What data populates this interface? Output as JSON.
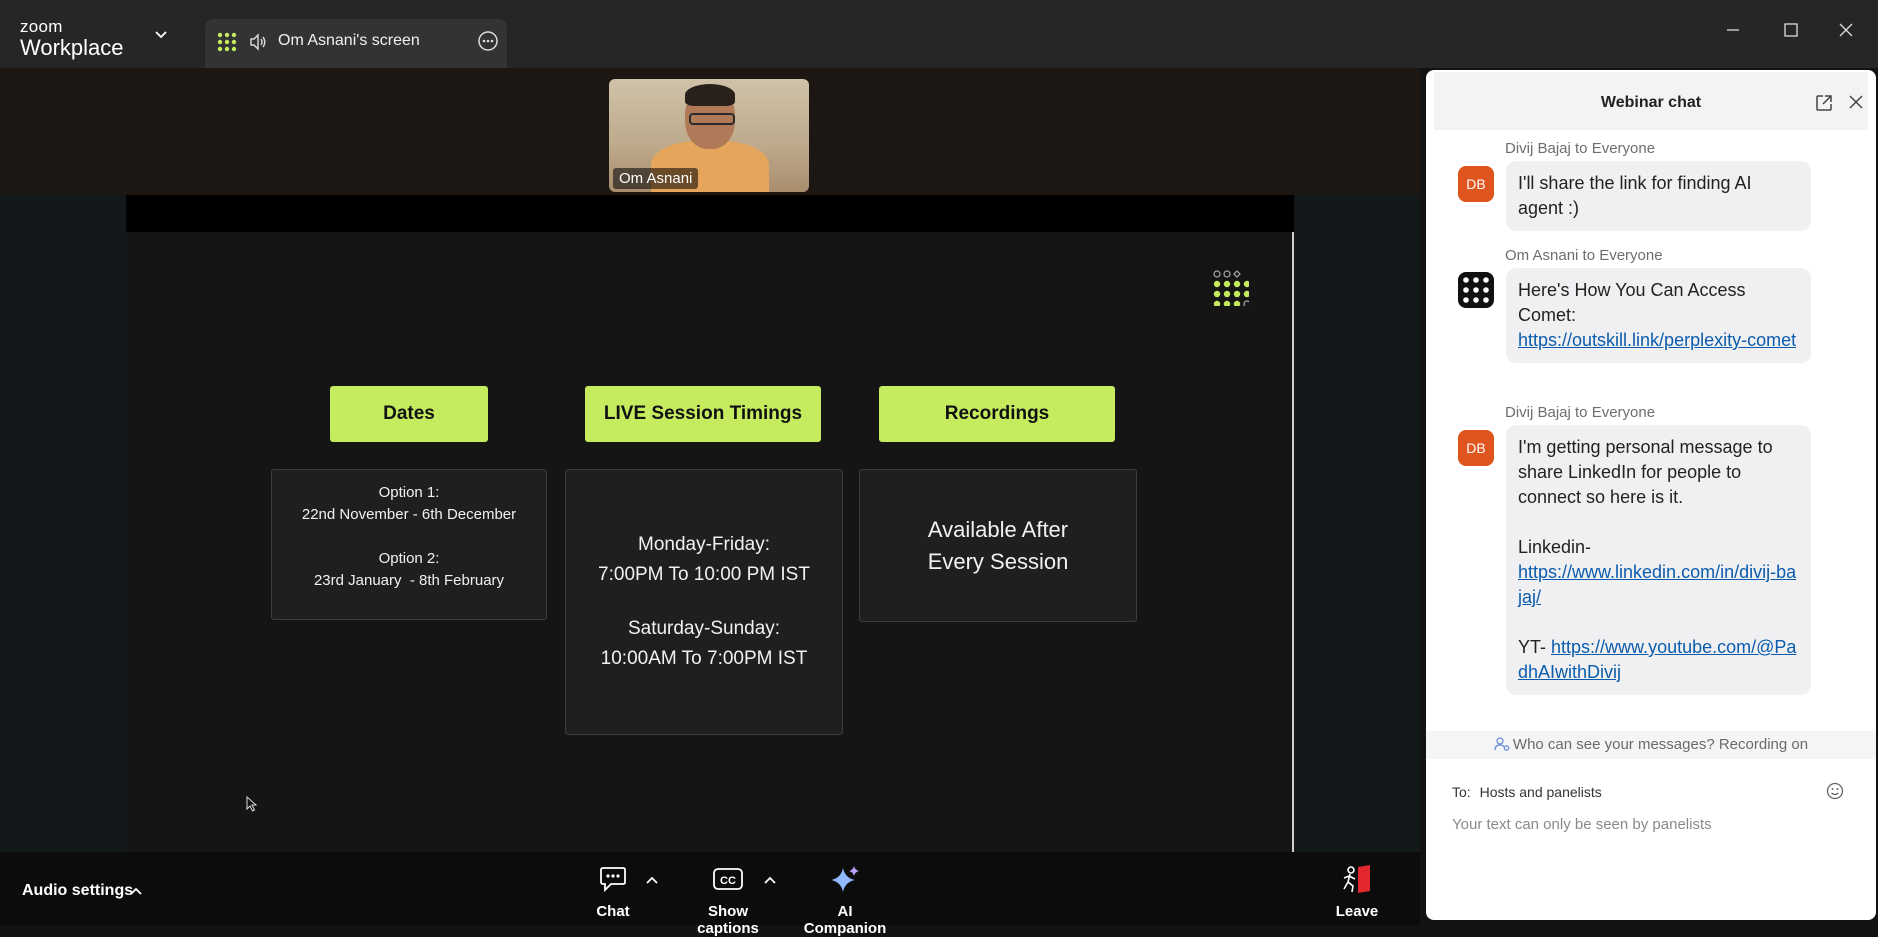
{
  "app": {
    "brand_line1": "zoom",
    "brand_line2": "Workplace"
  },
  "share_tab": {
    "label": "Om Asnani's screen"
  },
  "video": {
    "participant_name": "Om Asnani"
  },
  "slide": {
    "tags": [
      "Dates",
      "LIVE Session Timings",
      "Recordings"
    ],
    "dates": {
      "line1": "Option 1:",
      "line2": "22nd November - 6th December",
      "line3": "Option 2:",
      "line4": "23rd January  - 8th February"
    },
    "timings": {
      "line1": "Monday-Friday:",
      "line2": "7:00PM To 10:00 PM IST",
      "line3": "Saturday-Sunday:",
      "line4": "10:00AM To 7:00PM IST"
    },
    "recordings": {
      "line1": "Available After",
      "line2": "Every Session"
    },
    "accent": "#c5ec5e"
  },
  "toolbar": {
    "audio_settings": "Audio settings",
    "chat": "Chat",
    "captions": "Show captions",
    "ai": "AI Companion",
    "leave": "Leave"
  },
  "chat": {
    "title": "Webinar chat",
    "messages": [
      {
        "meta": "Divij Bajaj to Everyone",
        "initials": "DB",
        "text": "I'll share the link for finding AI agent :)"
      },
      {
        "meta": "Om Asnani to Everyone",
        "text_prefix": "Here's How You Can Access Comet:",
        "link": "https://outskill.link/perplexity-comet"
      },
      {
        "meta": "Divij Bajaj to Everyone",
        "initials": "DB",
        "text": "I'm getting personal message to share LinkedIn for people to connect so here is it.",
        "linkedin_label": "Linkedin-",
        "linkedin_link": "https://www.linkedin.com/in/divij-bajaj/",
        "yt_label": "YT-",
        "yt_link": "https://www.youtube.com/@PadhAIwithDivij"
      }
    ],
    "privacy": "Who can see your messages? Recording on",
    "to_label": "To:",
    "to_value": "Hosts and panelists",
    "input_placeholder": "Your text can only be seen by panelists"
  }
}
